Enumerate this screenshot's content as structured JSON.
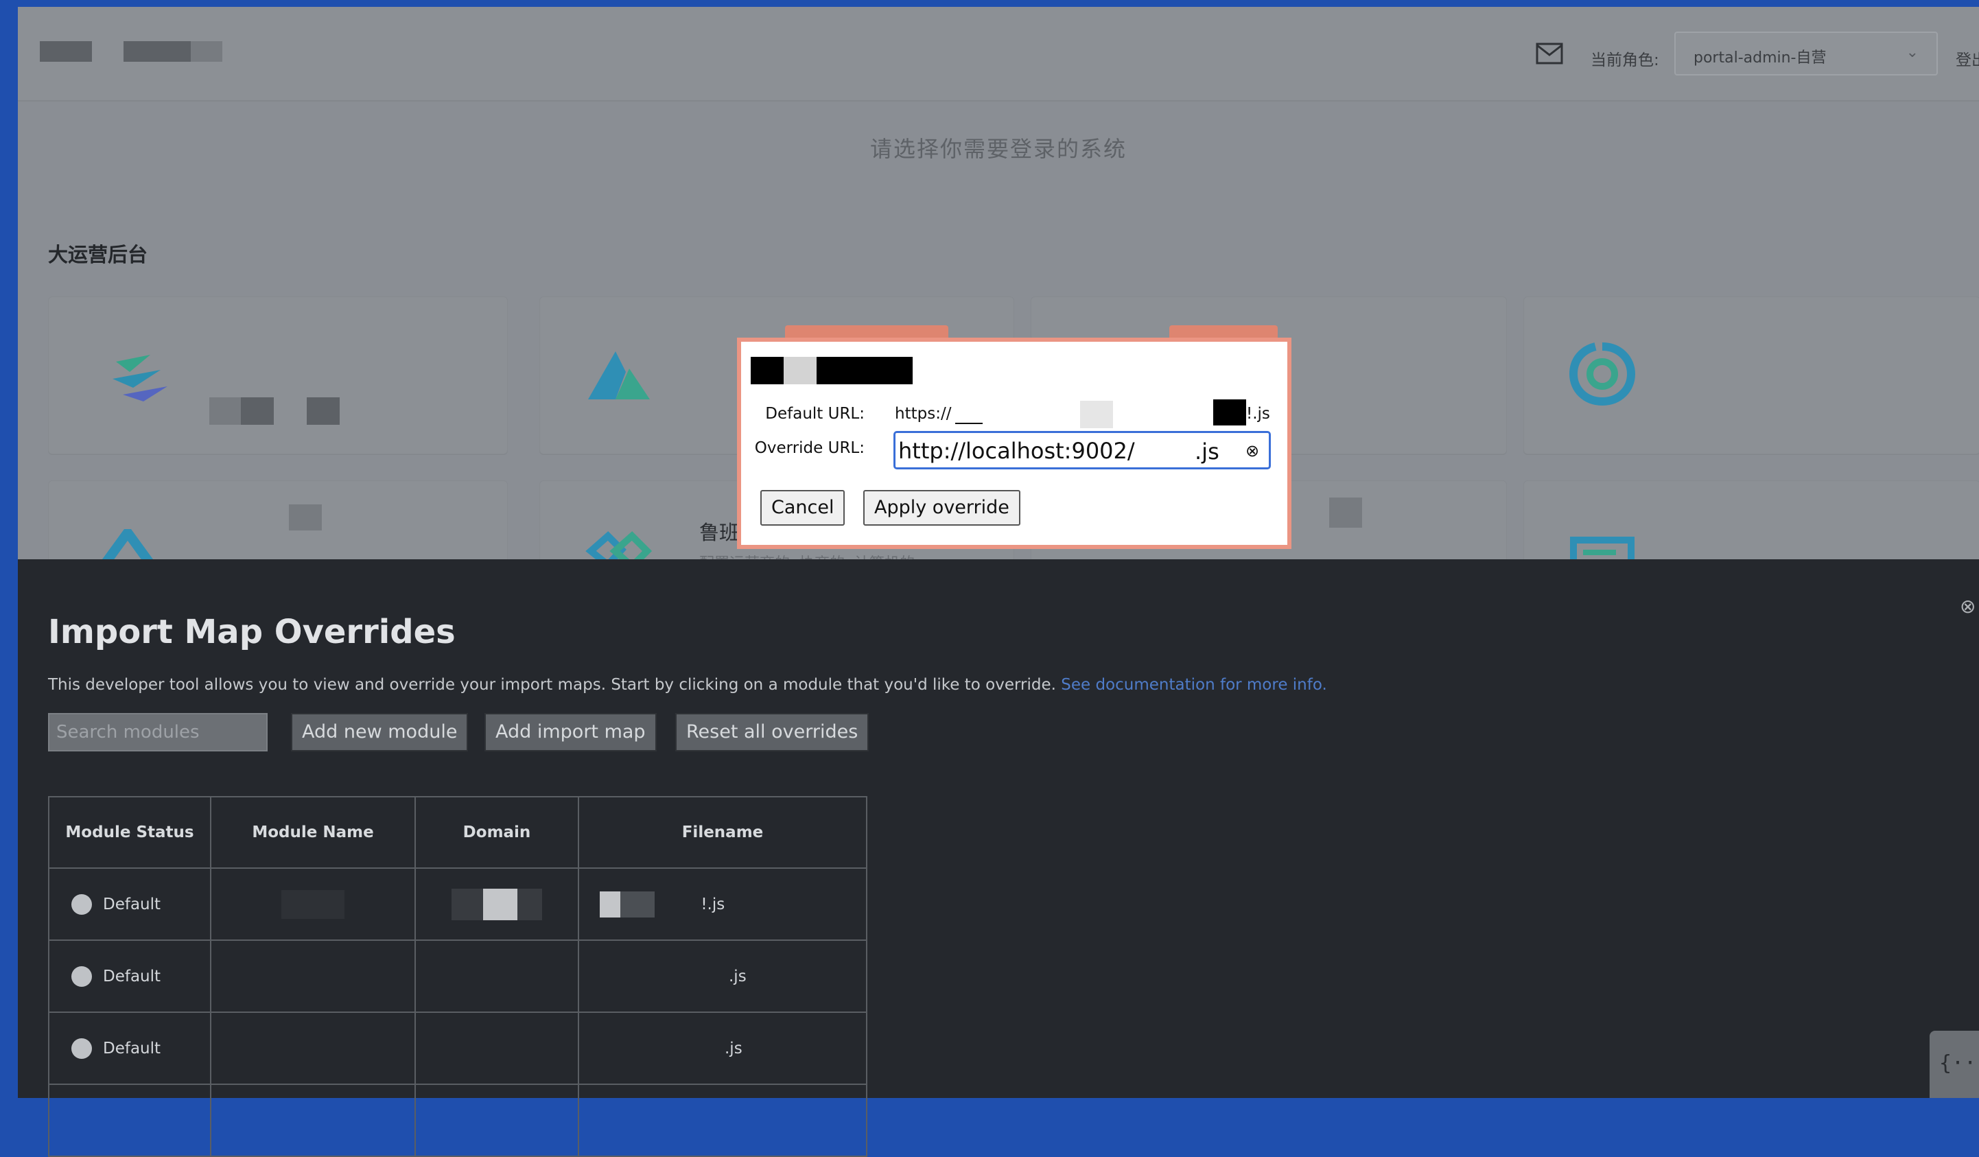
{
  "app": {
    "header": {
      "role_label": "当前角色:",
      "role_value": "portal-admin-自营",
      "login_label": "登出"
    },
    "choose_title": "请选择你需要登录的系统",
    "section_title": "大运营后台",
    "cards": [
      {
        "name": "",
        "desc": ""
      },
      {
        "name": "",
        "desc": ""
      },
      {
        "name": "",
        "desc": ""
      },
      {
        "name": "",
        "desc": ""
      },
      {
        "name": "",
        "desc": ""
      },
      {
        "name": "鲁班",
        "desc": "配置运营商的, 协商的, 计算机的"
      },
      {
        "name": "",
        "desc": ""
      },
      {
        "name": "",
        "desc": ""
      }
    ]
  },
  "dialog": {
    "default_url_label": "Default URL:",
    "default_url_value": "https://",
    "default_url_suffix": "!.js",
    "override_url_label": "Override URL:",
    "override_url_value": "http://localhost:9002/",
    "override_url_suffix": ".js",
    "clear_icon": "clear-circle-icon",
    "cancel_label": "Cancel",
    "apply_label": "Apply override"
  },
  "panel": {
    "title": "Import Map Overrides",
    "description": "This developer tool allows you to view and override your import maps. Start by clicking on a module that you'd like to override.",
    "doc_link": "See documentation for more info.",
    "search_placeholder": "Search modules",
    "add_module_label": "Add new module",
    "add_import_map_label": "Add import map",
    "reset_label": "Reset all overrides",
    "table": {
      "headers": [
        "Module Status",
        "Module Name",
        "Domain",
        "Filename"
      ],
      "rows": [
        {
          "status": "Default",
          "name": "",
          "domain": "",
          "filename": "!.js"
        },
        {
          "status": "Default",
          "name": "",
          "domain": "",
          "filename": ".js"
        },
        {
          "status": "Default",
          "name": "",
          "domain": "",
          "filename": ".js"
        }
      ]
    }
  },
  "colors": {
    "page_border": "#1f4fae",
    "panel_bg": "#25282d",
    "dialog_border": "#eb9583",
    "input_focus": "#3a6fd8",
    "link": "#4f7cc9"
  }
}
